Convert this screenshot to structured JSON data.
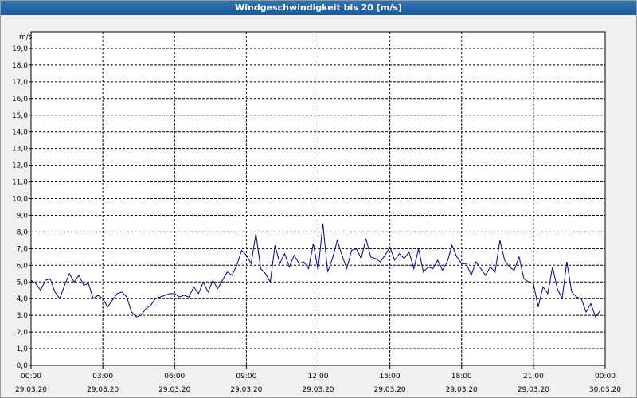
{
  "window": {
    "title": "Windgeschwindigkeit bis 20 [m/s]"
  },
  "chart_data": {
    "type": "line",
    "title": "Windgeschwindigkeit bis 20 [m/s]",
    "ylabel": "m/s",
    "ylim": [
      0,
      20
    ],
    "xlim": [
      0,
      24
    ],
    "grid": true,
    "line_color": "#00008b",
    "y_ticks": [
      "0,0",
      "1,0",
      "2,0",
      "3,0",
      "4,0",
      "5,0",
      "6,0",
      "7,0",
      "8,0",
      "9,0",
      "10,0",
      "11,0",
      "12,0",
      "13,0",
      "14,0",
      "15,0",
      "16,0",
      "17,0",
      "18,0",
      "19,0"
    ],
    "x_ticks": [
      {
        "time": "00:00",
        "date": "29.03.20"
      },
      {
        "time": "03:00",
        "date": "29.03.20"
      },
      {
        "time": "06:00",
        "date": "29.03.20"
      },
      {
        "time": "09:00",
        "date": "29.03.20"
      },
      {
        "time": "12:00",
        "date": "29.03.20"
      },
      {
        "time": "15:00",
        "date": "29.03.20"
      },
      {
        "time": "18:00",
        "date": "29.03.20"
      },
      {
        "time": "21:00",
        "date": "29.03.20"
      },
      {
        "time": "00:00",
        "date": "30.03.20"
      }
    ],
    "series": [
      {
        "x": [
          0.0,
          0.2,
          0.4,
          0.6,
          0.8,
          1.0,
          1.2,
          1.4,
          1.6,
          1.8,
          2.0,
          2.2,
          2.4,
          2.6,
          2.8,
          3.0,
          3.2,
          3.4,
          3.6,
          3.8,
          4.0,
          4.2,
          4.4,
          4.6,
          4.8,
          5.0,
          5.2,
          5.4,
          5.6,
          5.8,
          6.0,
          6.2,
          6.4,
          6.6,
          6.8,
          7.0,
          7.2,
          7.4,
          7.6,
          7.8,
          8.0,
          8.2,
          8.4,
          8.6,
          8.8,
          9.0,
          9.2,
          9.4,
          9.6,
          9.8,
          10.0,
          10.2,
          10.4,
          10.6,
          10.8,
          11.0,
          11.2,
          11.4,
          11.6,
          11.8,
          12.0,
          12.2,
          12.4,
          12.6,
          12.8,
          13.0,
          13.2,
          13.4,
          13.6,
          13.8,
          14.0,
          14.2,
          14.4,
          14.6,
          14.8,
          15.0,
          15.2,
          15.4,
          15.6,
          15.8,
          16.0,
          16.2,
          16.4,
          16.6,
          16.8,
          17.0,
          17.2,
          17.4,
          17.6,
          17.8,
          18.0,
          18.2,
          18.4,
          18.6,
          18.8,
          19.0,
          19.2,
          19.4,
          19.6,
          19.8,
          20.0,
          20.2,
          20.4,
          20.6,
          20.8,
          21.0,
          21.2,
          21.4,
          21.6,
          21.8,
          22.0,
          22.2,
          22.4,
          22.6,
          22.8,
          23.0,
          23.2,
          23.4,
          23.6,
          23.8
        ],
        "y": [
          5.1,
          4.9,
          4.5,
          5.1,
          5.2,
          4.4,
          4.0,
          4.8,
          5.5,
          5.0,
          5.4,
          4.8,
          4.9,
          4.0,
          4.2,
          4.0,
          3.5,
          3.9,
          4.3,
          4.4,
          4.1,
          3.2,
          2.9,
          3.0,
          3.4,
          3.6,
          4.0,
          4.1,
          4.2,
          4.3,
          4.3,
          4.1,
          4.2,
          4.1,
          4.7,
          4.3,
          5.0,
          4.4,
          5.1,
          4.6,
          5.1,
          5.6,
          5.4,
          6.0,
          6.9,
          6.6,
          6.1,
          7.9,
          5.8,
          5.5,
          5.0,
          7.2,
          6.1,
          6.7,
          5.9,
          6.6,
          6.1,
          6.2,
          5.8,
          7.3,
          5.7,
          8.5,
          5.6,
          6.4,
          7.5,
          6.6,
          5.8,
          6.9,
          7.0,
          6.4,
          7.6,
          6.5,
          6.4,
          6.2,
          6.6,
          7.1,
          6.3,
          6.7,
          6.4,
          6.8,
          5.8,
          7.0,
          5.6,
          5.9,
          5.8,
          6.3,
          5.7,
          6.2,
          7.2,
          6.5,
          6.1,
          6.1,
          5.4,
          6.2,
          5.8,
          5.4,
          5.9,
          5.6,
          7.5,
          6.3,
          5.9,
          5.7,
          6.5,
          5.2,
          5.0,
          4.9,
          3.5,
          4.7,
          4.3,
          5.9,
          4.6,
          4.0,
          6.2,
          4.4,
          4.1,
          4.0,
          3.2,
          3.7,
          2.9,
          3.3
        ]
      }
    ]
  }
}
